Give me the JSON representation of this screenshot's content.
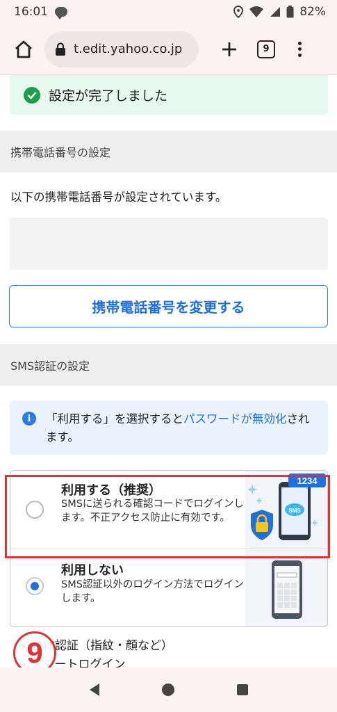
{
  "status_bar": {
    "time": "16:01",
    "battery": "82%",
    "icons": [
      "chat-icon",
      "location-icon",
      "wifi-icon",
      "signal-icon",
      "battery-icon"
    ]
  },
  "browser": {
    "url": "t.edit.yahoo.co.jp",
    "tab_count": "9",
    "icons": [
      "home-icon",
      "lock-icon",
      "plus-icon",
      "menu-icon"
    ]
  },
  "success": {
    "message": "設定が完了しました"
  },
  "phone_section": {
    "header": "携帯電話番号の設定",
    "description": "以下の携帯電話番号が設定されています。",
    "change_button": "携帯電話番号を変更する"
  },
  "sms_section": {
    "header": "SMS認証の設定",
    "info_prefix": "「利用する」を選択すると",
    "info_link": "パスワードが無効化",
    "info_suffix": "されます。",
    "options": [
      {
        "title": "利用する（推奨）",
        "description": "SMSに送られる確認コードでログインします。不正アクセス防止に有効です。",
        "selected": false,
        "illustration_badge": "1234",
        "illustration_sms": "SMS"
      },
      {
        "title": "利用しない",
        "description": "SMS認証以外のログイン方法でログインします。",
        "selected": true
      }
    ]
  },
  "bullets": [
    "生体認証（指紋・顔など）",
    "スマートログイン"
  ],
  "annotation": {
    "step_number": "9",
    "color": "#e23333"
  },
  "colors": {
    "accent": "#1f6fe0",
    "success": "#1e9e4a",
    "success_bg": "#e7f8ee",
    "info_bg": "#eaf3fd"
  }
}
